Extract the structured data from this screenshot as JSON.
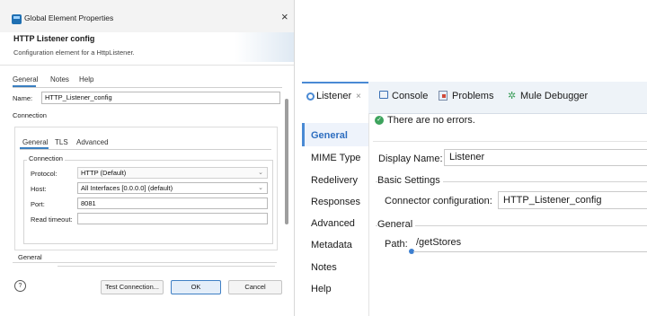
{
  "dialog": {
    "window_title": "Global Element Properties",
    "close_glyph": "×",
    "header_title": "HTTP Listener config",
    "header_subtitle": "Configuration element for a HttpListener.",
    "tabs": [
      "General",
      "Notes",
      "Help"
    ],
    "name_label": "Name:",
    "name_value": "HTTP_Listener_config",
    "connection_heading": "Connection",
    "inner_tabs": [
      "General",
      "TLS",
      "Advanced"
    ],
    "connection_group": "Connection",
    "protocol_label": "Protocol:",
    "protocol_value": "HTTP (Default)",
    "host_label": "Host:",
    "host_value": "All Interfaces [0.0.0.0] (default)",
    "port_label": "Port:",
    "port_value": "8081",
    "read_timeout_label": "Read timeout:",
    "read_timeout_value": "",
    "general_section": "General",
    "help_glyph": "?",
    "buttons": {
      "test": "Test Connection...",
      "ok": "OK",
      "cancel": "Cancel"
    },
    "accent_color": "#3a7fc0"
  },
  "editor": {
    "tabs": {
      "listener": "Listener",
      "listener_close": "×",
      "console": "Console",
      "problems": "Problems",
      "debugger": "Mule Debugger"
    },
    "nav": [
      "General",
      "MIME Type",
      "Redelivery",
      "Responses",
      "Advanced",
      "Metadata",
      "Notes",
      "Help"
    ],
    "status": "There are no errors.",
    "status_glyph": "✓",
    "display_name_label": "Display Name:",
    "display_name_value": "Listener",
    "basic_settings": "Basic Settings",
    "connector_label": "Connector configuration:",
    "connector_value": "HTTP_Listener_config",
    "general_group": "General",
    "path_label": "Path:",
    "path_value": "/getStores",
    "accent_color": "#4a8ad4",
    "icons": [
      "listener-icon",
      "console-icon",
      "problems-icon",
      "debugger-icon",
      "ok-icon"
    ]
  }
}
